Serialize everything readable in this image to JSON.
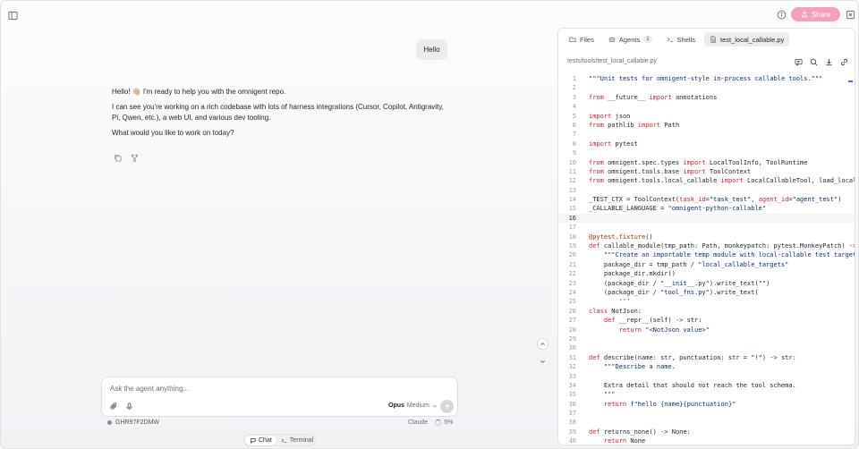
{
  "topbar": {
    "share_label": "Share"
  },
  "chat": {
    "user_message": "Hello",
    "assistant_paragraphs": [
      "Hello! 👋🏼 I'm ready to help you with the omnigent repo.",
      "I can see you're working on a rich codebase with lots of harness integrations (Cursor, Copilot, Antigravity, Pi, Qwen, etc.), a web UI, and various dev tooling.",
      "What would you like to work on today?"
    ]
  },
  "composer": {
    "placeholder": "Ask the agent anything...",
    "model": "Opus",
    "effort": "Medium"
  },
  "status": {
    "session_id": "GHR97F2DMW",
    "agent": "Claude",
    "context_pct": "5%"
  },
  "modes": {
    "chat": "Chat",
    "terminal": "Terminal"
  },
  "panel": {
    "tabs": {
      "files": "Files",
      "agents": "Agents",
      "agents_count": "1",
      "shells": "Shells",
      "file": "test_local_callable.py"
    },
    "file_path": "tests/tools/test_local_callable.py",
    "current_line": 16,
    "code_lines": [
      "\"\"\"Unit tests for omnigent-style in-process callable tools.\"\"\"",
      "",
      "from __future__ import annotations",
      "",
      "import json",
      "from pathlib import Path",
      "",
      "import pytest",
      "",
      "from omnigent.spec.types import LocalToolInfo, ToolRuntime",
      "from omnigent.tools.base import ToolContext",
      "from omnigent.tools.local_callable import LocalCallableTool, load_local_ca",
      "",
      "_TEST_CTX = ToolContext(task_id=\"task_test\", agent_id=\"agent_test\")",
      "_CALLABLE_LANGUAGE = \"omnigent-python-callable\"",
      "",
      "",
      "@pytest.fixture()",
      "def callable_module(tmp_path: Path, monkeypatch: pytest.MonkeyPatch) -> st",
      "    \"\"\"Create an importable temp module with local-callable test targets.\"",
      "    package_dir = tmp_path / \"local_callable_targets\"",
      "    package_dir.mkdir()",
      "    (package_dir / \"__init__.py\").write_text(\"\")",
      "    (package_dir / \"tool_fns.py\").write_text(",
      "        '''",
      "class NotJson:",
      "    def __repr__(self) -> str:",
      "        return \"<NotJson value>\"",
      "",
      "",
      "def describe(name: str, punctuation: str = \"!\") -> str:",
      "    \"\"\"Describe a name.",
      "",
      "    Extra detail that should not reach the tool schema.",
      "    \"\"\"",
      "    return f\"hello {name}{punctuation}\"",
      "",
      "",
      "def returns_none() -> None:",
      "    return None"
    ]
  }
}
